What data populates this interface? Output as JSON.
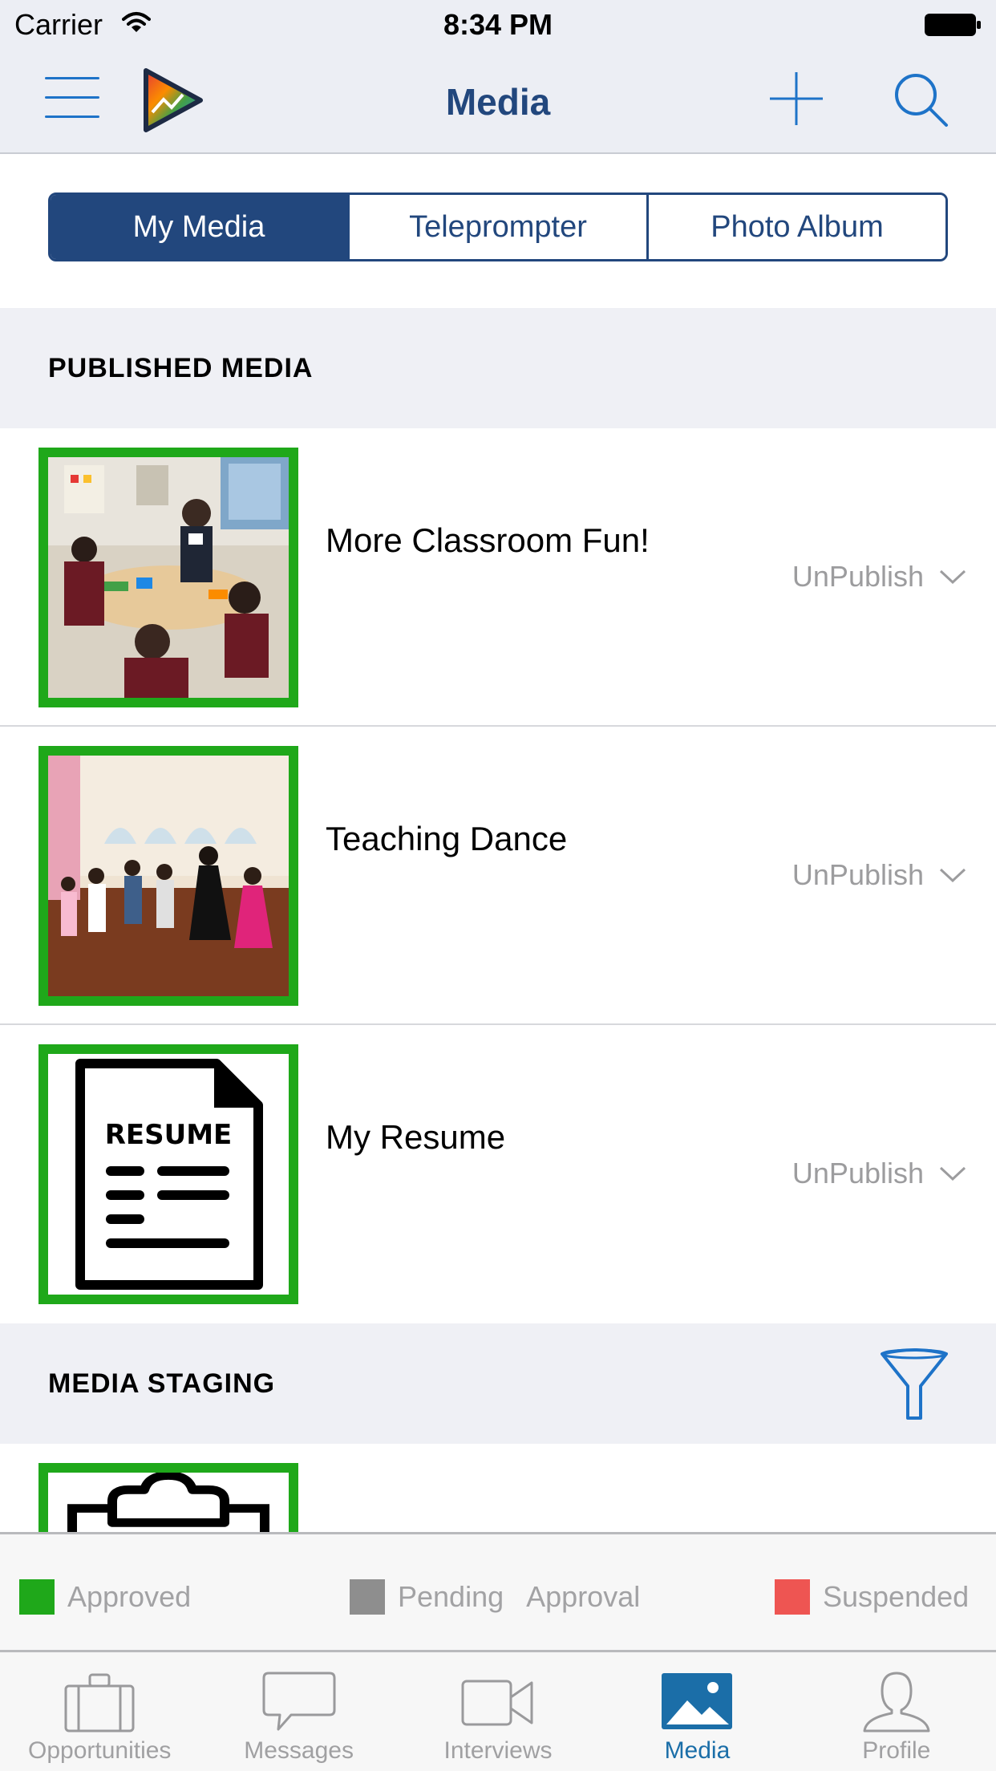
{
  "status_bar": {
    "carrier": "Carrier",
    "time": "8:34 PM"
  },
  "nav": {
    "title": "Media"
  },
  "segments": [
    {
      "label": "My Media",
      "active": true
    },
    {
      "label": "Teleprompter",
      "active": false
    },
    {
      "label": "Photo Album",
      "active": false
    }
  ],
  "published": {
    "header": "PUBLISHED MEDIA",
    "items": [
      {
        "title": "More Classroom Fun!",
        "action": "UnPublish",
        "thumb": "classroom-photo"
      },
      {
        "title": "Teaching Dance",
        "action": "UnPublish",
        "thumb": "dance-photo"
      },
      {
        "title": "My Resume",
        "action": "UnPublish",
        "thumb": "resume-icon"
      }
    ]
  },
  "staging": {
    "header": "MEDIA STAGING"
  },
  "legend": [
    {
      "label": "Approved",
      "color": "#1fa81a"
    },
    {
      "label": "Pending   Approval",
      "color": "#8e8e8e"
    },
    {
      "label": "Suspended",
      "color": "#ee5552"
    }
  ],
  "tabs": [
    {
      "label": "Opportunities",
      "icon": "briefcase-icon",
      "active": false
    },
    {
      "label": "Messages",
      "icon": "chat-bubble-icon",
      "active": false
    },
    {
      "label": "Interviews",
      "icon": "video-camera-icon",
      "active": false
    },
    {
      "label": "Media",
      "icon": "photo-icon",
      "active": true
    },
    {
      "label": "Profile",
      "icon": "person-icon",
      "active": false
    }
  ],
  "colors": {
    "brand_navy": "#22477d",
    "accent_blue": "#1e73c8",
    "approved_border": "#1fa81a",
    "active_tab": "#1b6ea8"
  }
}
